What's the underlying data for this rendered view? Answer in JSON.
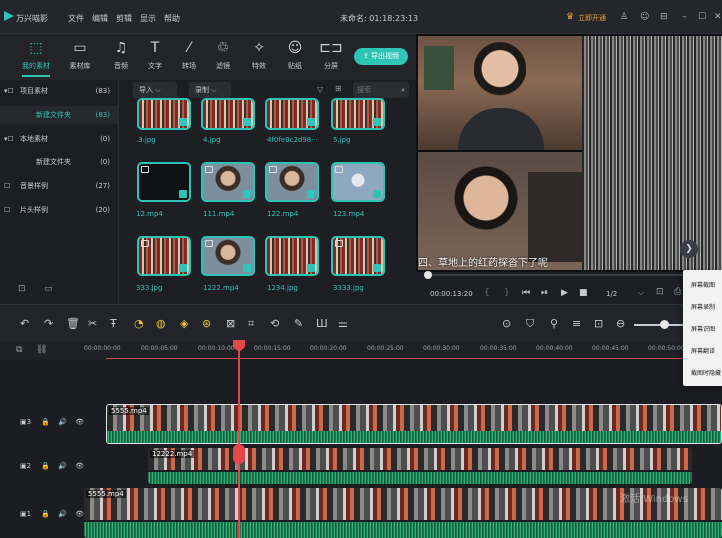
{
  "titlebar": {
    "app_name": "万兴喵影",
    "menus": [
      "文件",
      "编辑",
      "剪辑",
      "显示",
      "帮助"
    ],
    "project_title": "未命名: 01:18:23:13",
    "upgrade_label": "立即开通"
  },
  "media_toolbar": {
    "tabs": [
      {
        "label": "我的素材",
        "icon": "my-media-icon"
      },
      {
        "label": "素材库",
        "icon": "library-icon"
      },
      {
        "label": "音频",
        "icon": "audio-icon"
      },
      {
        "label": "文字",
        "icon": "text-icon"
      },
      {
        "label": "转场",
        "icon": "transition-icon"
      },
      {
        "label": "滤镜",
        "icon": "filter-icon"
      },
      {
        "label": "特效",
        "icon": "effects-icon"
      },
      {
        "label": "贴纸",
        "icon": "sticker-icon"
      },
      {
        "label": "分屏",
        "icon": "splitscreen-icon"
      }
    ],
    "export_label": "导出视频"
  },
  "sidebar": {
    "items": [
      {
        "label": "项目素材",
        "count": "(83)"
      },
      {
        "label": "新建文件夹",
        "count": "(83)"
      },
      {
        "label": "本地素材",
        "count": "(0)"
      },
      {
        "label": "新建文件夹",
        "count": "(0)"
      },
      {
        "label": "音景样例",
        "count": "(27)"
      },
      {
        "label": "片头样例",
        "count": "(20)"
      }
    ]
  },
  "media": {
    "import_label": "导入",
    "record_label": "录制",
    "search_placeholder": "搜索",
    "items": [
      {
        "name": ".3.jpg"
      },
      {
        "name": "4.jpg"
      },
      {
        "name": "4f0fe0c2d98···"
      },
      {
        "name": "5.jpg"
      },
      {
        "name": "12.mp4"
      },
      {
        "name": "111.mp4"
      },
      {
        "name": "122.mp4"
      },
      {
        "name": "123.mp4"
      },
      {
        "name": "333.jpg"
      },
      {
        "name": "1222.mp4"
      },
      {
        "name": "1234.jpg"
      },
      {
        "name": "3333.jpg"
      }
    ]
  },
  "preview": {
    "subtitle": "四、草地上的红药探沓下了呢",
    "timecode": "00:00:13:20",
    "quality": "1/2"
  },
  "context_menu": {
    "items": [
      "屏幕截图",
      "屏幕录制",
      "屏幕识图",
      "屏幕翻译",
      "截图时隐藏"
    ]
  },
  "timeline": {
    "ruler": [
      "00:00:00:00",
      "00:00:05:00",
      "00:00:10:00",
      "00:00:15:00",
      "00:00:20:00",
      "00:00:25:00",
      "00:00:30:00",
      "00:00:35:00",
      "00:00:40:00",
      "00:00:45:00",
      "00:00:50:00"
    ],
    "tracks": [
      {
        "label": "3",
        "clip": "5555.mp4"
      },
      {
        "label": "2",
        "clip": "12222.mp4"
      },
      {
        "label": "1",
        "clip": "5555.mp4"
      }
    ],
    "watermark": "激活 Windows"
  }
}
